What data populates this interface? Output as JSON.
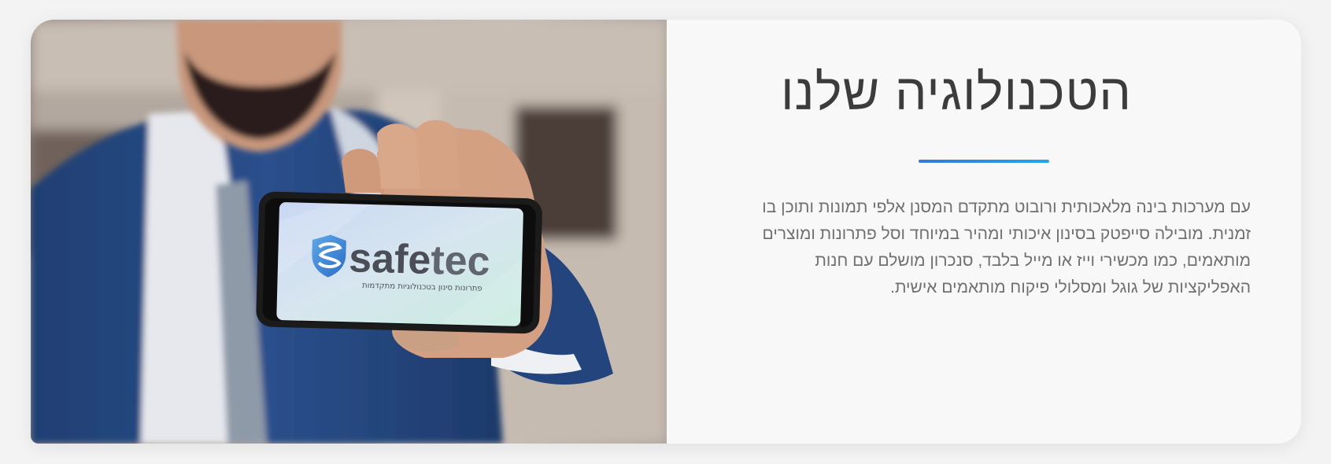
{
  "hero": {
    "title": "הטכנולוגיה שלנו",
    "description": "עם מערכות בינה מלאכותית ורובוט מתקדם המסנן אלפי תמונות ותוכן בו זמנית. מובילה סייפטק בסינון איכותי ומהיר במיוחד וסל פתרונות ומוצרים מותאמים, כמו מכשירי וייז או מייל בלבד, סנכרון מושלם עם חנות האפליקציות של גוגל ומסלולי פיקוח מותאמים אישית.",
    "accent_color": "#2f86dc"
  },
  "image": {
    "logo_main": "safe",
    "logo_accent": "tec",
    "logo_tagline": "פתרונות סינון בטכנולוגיות מתקדמות",
    "shield_icon": "shield-icon"
  }
}
